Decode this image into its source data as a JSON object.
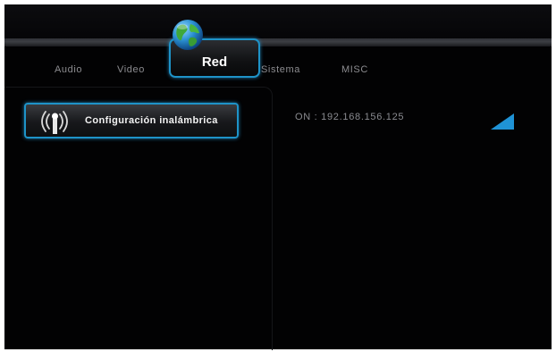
{
  "tabs": [
    {
      "label": "Audio"
    },
    {
      "label": "Video"
    },
    {
      "label": "Red"
    },
    {
      "label": "Sistema"
    },
    {
      "label": "MISC"
    }
  ],
  "active_tab_index": 2,
  "menu": {
    "items": [
      {
        "label": "Configuración inalámbrica",
        "icon": "wireless-antenna-icon",
        "selected": true
      }
    ]
  },
  "status": {
    "text": "ON : 192.168.156.125"
  },
  "icons": {
    "header": "globe-icon",
    "signal": "signal-strength-icon"
  },
  "colors": {
    "accent": "#1e93c8",
    "background": "#020203",
    "text_dim": "#8c8c90",
    "text_bright": "#ffffff"
  }
}
